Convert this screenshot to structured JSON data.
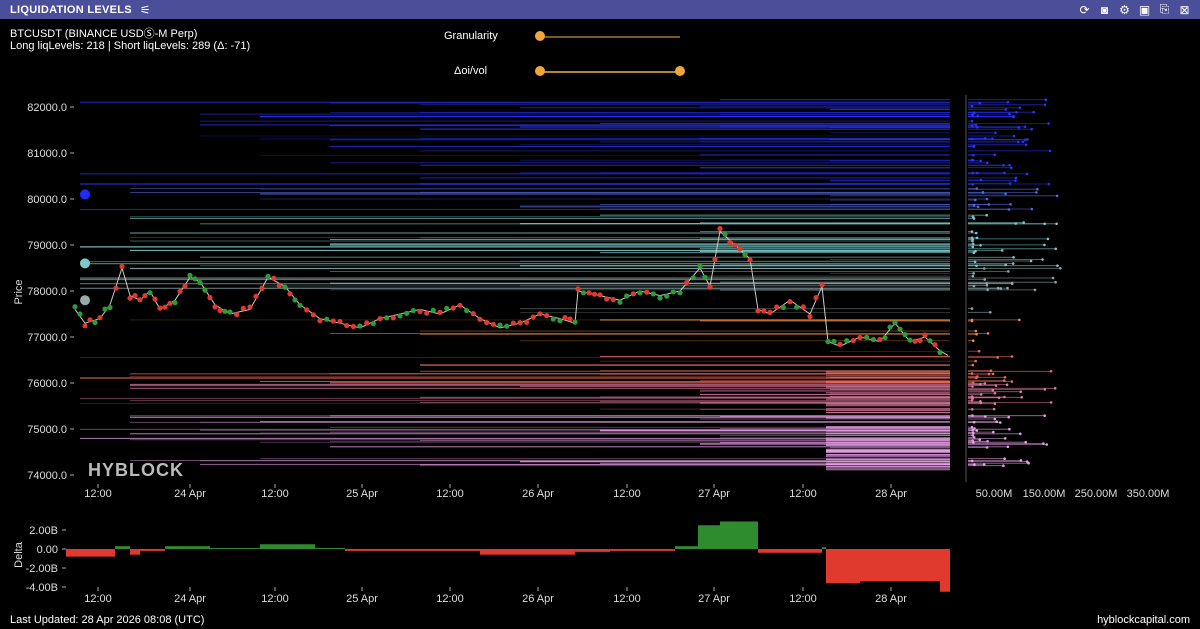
{
  "app": {
    "title": "LIQUIDATION LEVELS",
    "toolbar_icons": [
      "refresh-icon",
      "camera-icon",
      "gear-icon",
      "save-icon",
      "export-icon",
      "close-icon"
    ]
  },
  "header": {
    "symbol": "BTCUSDT (BINANCE USDⓈ-M Perp)",
    "stats": "Long liqLevels: 218 | Short liqLevels: 289 (Δ: -71)"
  },
  "controls": {
    "granularity": {
      "label": "Granularity",
      "value": 0.0
    },
    "doi_vol": {
      "label": "Δoi/vol",
      "range": [
        0.0,
        1.0
      ]
    }
  },
  "watermark": "HYBLOCK",
  "main_chart": {
    "ylabel": "Price",
    "yticks": [
      "82000.0",
      "81000.0",
      "80000.0",
      "79000.0",
      "78000.0",
      "77000.0",
      "76000.0",
      "75000.0",
      "74000.0"
    ],
    "xticks": [
      "12:00",
      "24 Apr",
      "12:00",
      "25 Apr",
      "12:00",
      "26 Apr",
      "12:00",
      "27 Apr",
      "12:00",
      "28 Apr"
    ],
    "histogram_ticks": [
      "50.00M",
      "150.00M",
      "250.00M",
      "350.00M"
    ]
  },
  "delta_chart": {
    "ylabel": "Delta",
    "yticks": [
      "2.00B",
      "0.00",
      "-2.00B",
      "-4.00B"
    ],
    "xticks": [
      "12:00",
      "24 Apr",
      "12:00",
      "25 Apr",
      "12:00",
      "26 Apr",
      "12:00",
      "27 Apr",
      "12:00",
      "28 Apr"
    ]
  },
  "colors": {
    "titlebar": "#4b4f9a",
    "up": "#2e8b2e",
    "down": "#e03a2f",
    "accent": "#f0a63a"
  },
  "footer": {
    "last_updated": "Last Updated: 28 Apr 2026 08:08 (UTC)",
    "brand": "hyblockcapital.com"
  }
}
